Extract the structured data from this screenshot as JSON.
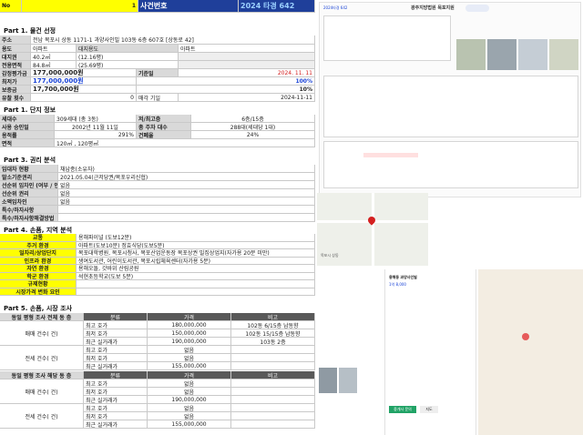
{
  "header": {
    "no_label": "No",
    "no_value": "1",
    "case_label": "사건번호",
    "case_number": "2024 타경 642"
  },
  "part1": {
    "title": "Part 1. 물건 선정",
    "address_label": "주소",
    "address_value": "전남 목포시 상동 1171-1 과양사인빌 103동 6층 607호 [상동로 42]",
    "use_label": "용도",
    "use_value": "아파트",
    "land_use_label": "대지용도",
    "building_label": "아파트",
    "land_area_label": "대지권",
    "land_area_value": "40.2㎡",
    "land_area_pyeong": "(12.16평)",
    "exclusive_label": "전용면적",
    "exclusive_value": "84.8㎡",
    "exclusive_pyeong": "(25.69평)",
    "appraisal_label": "감정평가금",
    "appraisal_value": "177,000,000원",
    "base_date_label": "기준일",
    "base_date_value": "2024. 11. 11",
    "min_price_label": "최저가",
    "min_price_value": "177,000,000원",
    "min_price_rate": "100%",
    "deposit_label": "보증금",
    "deposit_value": "17,700,000원",
    "deposit_rate": "10%",
    "fail_label": "유찰 횟수",
    "fail_value": "0",
    "sale_date_label": "매각 기일",
    "sale_date_value": "2024-11-11"
  },
  "part2": {
    "title": "Part 1. 단지 정보",
    "households_label": "세대수",
    "households_value": "309세대 (총 3동)",
    "floor_label": "저/최고층",
    "floor_value": "6층/15층",
    "approval_label": "사용 승인일",
    "approval_value": "2002년 11월 11일",
    "parking_label": "총 주차 대수",
    "parking_value": "288대(세대당 1대)",
    "far_label": "용적률",
    "far_value": "291%",
    "bcr_label": "건폐율",
    "bcr_value": "24%",
    "area_label": "면적",
    "area_value": "120㎡ , 120평㎡"
  },
  "part3": {
    "title": "Part 3. 권리 분석",
    "rows": [
      {
        "label": "임대차 현황",
        "value": "채납종(소유자)"
      },
      {
        "label": "말소기준권리",
        "value": "2021.05.04(근저당권/목포우리신협)"
      },
      {
        "label": "선순위 임차인 (여부 / 인",
        "value": "없음"
      },
      {
        "label": "선순위 권리",
        "value": "없음"
      },
      {
        "label": "소액임차인",
        "value": "없음"
      },
      {
        "label": "특수/하자사항",
        "value": ""
      },
      {
        "label": "특수/하자사항해결방법",
        "value": ""
      }
    ]
  },
  "part4": {
    "title": "Part 4. 손품, 지역 분석",
    "rows": [
      {
        "label": "교통",
        "value": "용해파이널 (도보12분)"
      },
      {
        "label": "주거 환경",
        "value": "아파트(도보10분) 정효식당(도보5분)"
      },
      {
        "label": "일자리/상업단지",
        "value": "목포대학병원, 목포시청사, 목포산업운동장 목포상권 밀집상업지(자가용 20분 미만)"
      },
      {
        "label": "인프라 환경",
        "value": "생여도서관, 어린이도서관, 목포시립체육센터(자가용 5분)"
      },
      {
        "label": "자연 환경",
        "value": "용해오돌, 갓바위 산림공원"
      },
      {
        "label": "학군 환경",
        "value": "석현초등학교(도보 5분)"
      },
      {
        "label": "규제현황",
        "value": ""
      },
      {
        "label": "시장가격 변화 요인",
        "value": ""
      }
    ]
  },
  "part5": {
    "title": "Part 5. 손품, 시장 조사",
    "table1": {
      "corner": "동일 평형 조사 전체 동 층",
      "col_kind": "분류",
      "col_price": "가격",
      "col_note": "비고",
      "groups": [
        {
          "label": "매매 건수( 건)",
          "rows": [
            {
              "kind": "최고 호가",
              "price": "180,000,000",
              "note": "102동 6/15층 남동향"
            },
            {
              "kind": "최저 호가",
              "price": "150,000,000",
              "note": "102동 15/15층 남동향"
            },
            {
              "kind": "최근 실거래가",
              "price": "190,000,000",
              "note": "103동 2층"
            }
          ]
        },
        {
          "label": "전세 건수( 건)",
          "rows": [
            {
              "kind": "최고 호가",
              "price": "없음",
              "note": ""
            },
            {
              "kind": "최저 호가",
              "price": "없음",
              "note": ""
            },
            {
              "kind": "최근 실거래가",
              "price": "155,000,000",
              "note": ""
            }
          ]
        }
      ]
    },
    "table2": {
      "corner": "동일 평형 조사 해당 동 층",
      "col_kind": "분류",
      "col_price": "가격",
      "col_note": "비고",
      "groups": [
        {
          "label": "매매 건수( 건)",
          "rows": [
            {
              "kind": "최고 호가",
              "price": "없음",
              "note": ""
            },
            {
              "kind": "최저 호가",
              "price": "없음",
              "note": ""
            },
            {
              "kind": "최근 실거래가",
              "price": "190,000,000",
              "note": ""
            }
          ]
        },
        {
          "label": "전세 건수( 건)",
          "rows": [
            {
              "kind": "최고 호가",
              "price": "없음",
              "note": ""
            },
            {
              "kind": "최저 호가",
              "price": "없음",
              "note": ""
            },
            {
              "kind": "최근 실거래가",
              "price": "155,000,000",
              "note": ""
            }
          ]
        }
      ]
    }
  },
  "panel": {
    "doc_title": "광주지방법원 목포지원",
    "doc_case": "2024타경 642",
    "map_label": "목포시 상동",
    "listing_title": "용해동 과양사인빌",
    "listing_price": "1억 8,000",
    "btn_contact": "중개사 문의",
    "btn_map": "지도"
  },
  "colors": {
    "header_blue": "#1f3f9a",
    "section_yellow": "#ffff00",
    "label_gray": "#d9d9d9",
    "accent_blue": "#1a43d6",
    "accent_red": "#d42020"
  }
}
